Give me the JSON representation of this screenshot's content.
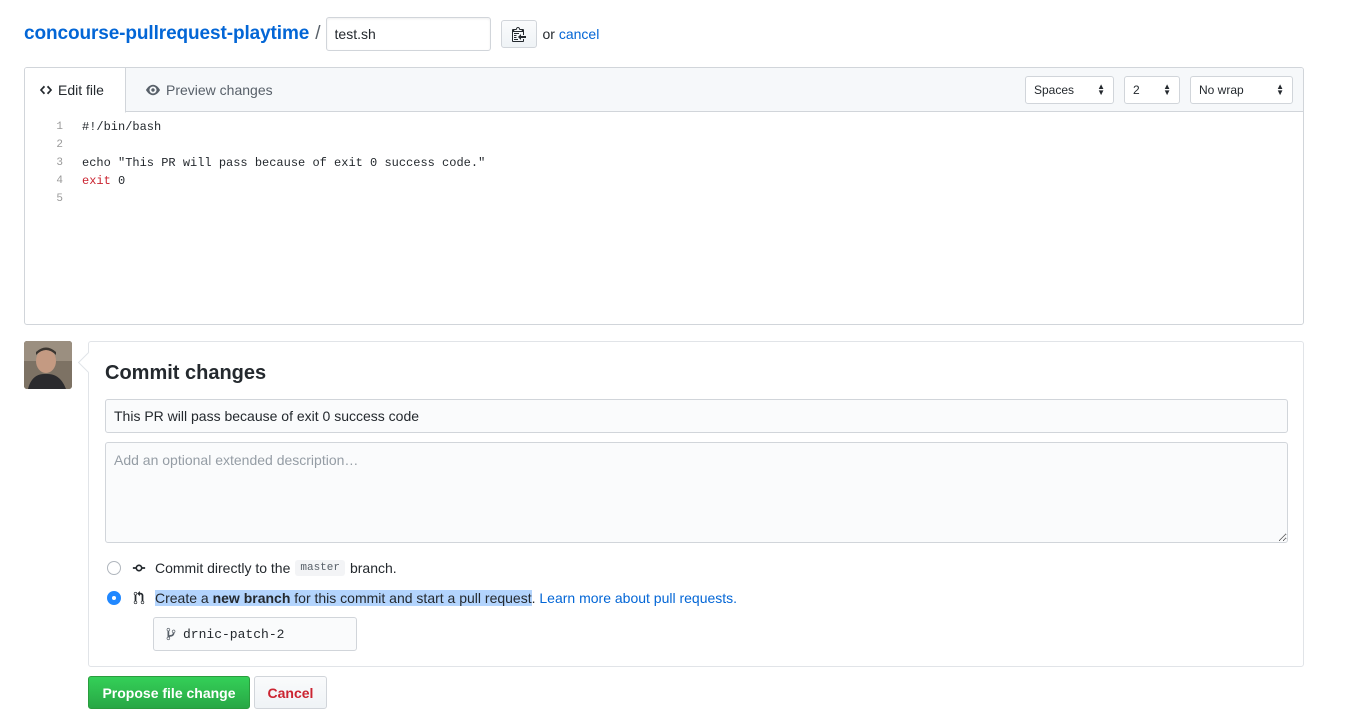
{
  "breadcrumb": {
    "repo": "concourse-pullrequest-playtime",
    "separator": "/",
    "filename": "test.sh",
    "or_text": "or",
    "cancel_link": "cancel"
  },
  "editor": {
    "tab_edit": "Edit file",
    "tab_preview": "Preview changes",
    "indent_mode": "Spaces",
    "indent_size": "2",
    "wrap_mode": "No wrap",
    "lines": [
      {
        "num": "1",
        "text": "#!/bin/bash"
      },
      {
        "num": "2",
        "text": ""
      },
      {
        "num": "3",
        "text": "echo \"This PR will pass because of exit 0 success code.\""
      },
      {
        "num": "4",
        "keyword": "exit",
        "rest": " 0"
      },
      {
        "num": "5",
        "text": ""
      }
    ]
  },
  "commit": {
    "title": "Commit changes",
    "summary": "This PR will pass because of exit 0 success code",
    "description_placeholder": "Add an optional extended description…",
    "direct_prefix": "Commit directly to the",
    "direct_branch": "master",
    "direct_suffix": "branch.",
    "new_prefix": "Create a",
    "new_bold": "new branch",
    "new_suffix": "for this commit and start a pull request",
    "new_period": ".",
    "learn_more": "Learn more about pull requests.",
    "branch_name": "drnic-patch-2",
    "selected_option": "new-branch"
  },
  "buttons": {
    "propose": "Propose file change",
    "cancel": "Cancel"
  },
  "colors": {
    "link": "#0366d6",
    "primary_green": "#28a745",
    "danger": "#cb2431",
    "selection": "#b3d4fd"
  },
  "icons": {
    "code": "code-icon",
    "eye": "eye-icon",
    "clipboard": "clipboard-icon",
    "commit": "git-commit-icon",
    "pull_request": "git-pull-request-icon",
    "branch": "git-branch-icon"
  }
}
